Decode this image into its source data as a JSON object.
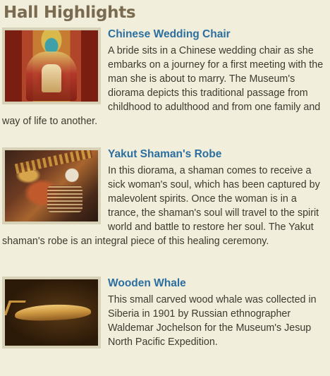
{
  "page": {
    "title": "Hall Highlights"
  },
  "items": [
    {
      "title": "Chinese Wedding Chair",
      "image_alt": "chinese-wedding-chair-image",
      "text": "A bride sits in a Chinese wedding chair as she embarks on a journey for a first meeting with the man she is about to marry. The Museum's diorama depicts this traditional passage from childhood to adulthood and from one family and way of life to another."
    },
    {
      "title": "Yakut Shaman's Robe",
      "image_alt": "yakut-shaman-robe-image",
      "text": "In this diorama, a shaman comes to receive a sick woman's soul, which has been captured by malevolent spirits. Once the woman is in a trance, the shaman's soul will travel to the spirit world and battle to restore her soul. The Yakut shaman's robe is an integral piece of this healing ceremony."
    },
    {
      "title": "Wooden Whale",
      "image_alt": "wooden-whale-image",
      "text": "This small carved wood whale was collected in Siberia in 1901 by Russian ethnographer Waldemar Jochelson for the Museum's Jesup North Pacific Expedition."
    }
  ],
  "colors": {
    "background": "#f1eedc",
    "title": "#7a6a4f",
    "link": "#2c6f9f",
    "text": "#3d3a2e",
    "thumb_frame": "#d7d1b7"
  }
}
